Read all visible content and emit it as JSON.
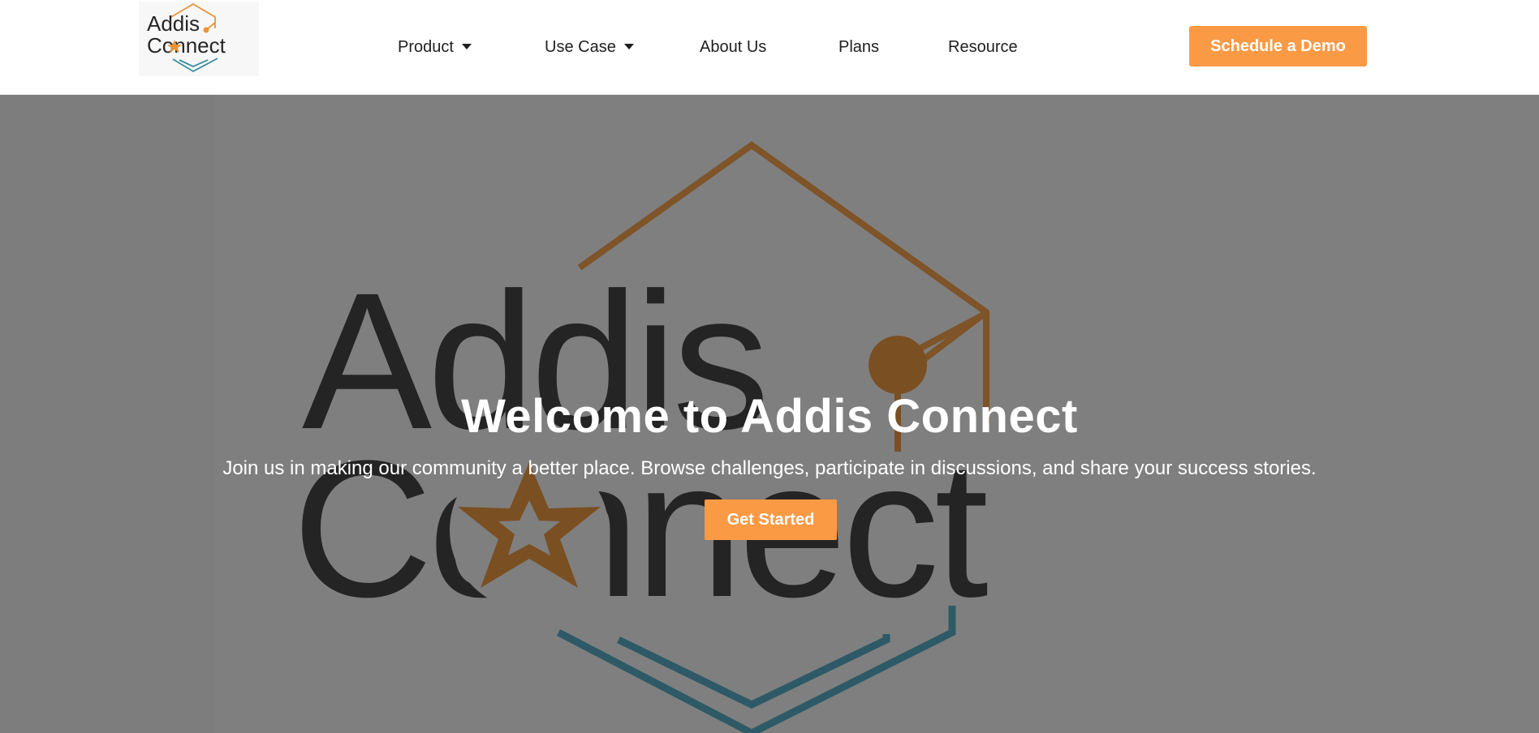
{
  "brand": {
    "logo_line1": "Addis",
    "logo_line2": "Connect",
    "accent_color": "#fb9a45",
    "logo_orange": "#e8943a",
    "logo_teal": "#3a8ea0"
  },
  "nav": {
    "items": [
      {
        "label": "Product",
        "has_dropdown": true
      },
      {
        "label": "Use Case",
        "has_dropdown": true
      },
      {
        "label": "About Us",
        "has_dropdown": false
      },
      {
        "label": "Plans",
        "has_dropdown": false
      },
      {
        "label": "Resource",
        "has_dropdown": false
      }
    ],
    "cta_label": "Schedule a Demo"
  },
  "hero": {
    "title": "Welcome to Addis Connect",
    "subtitle": "Join us in making our community a better place. Browse challenges, participate in discussions, and share your success stories.",
    "button_label": "Get Started",
    "background_color": "#7f7f7f",
    "art_word_1": "Addis",
    "art_word_2": "Connect"
  }
}
